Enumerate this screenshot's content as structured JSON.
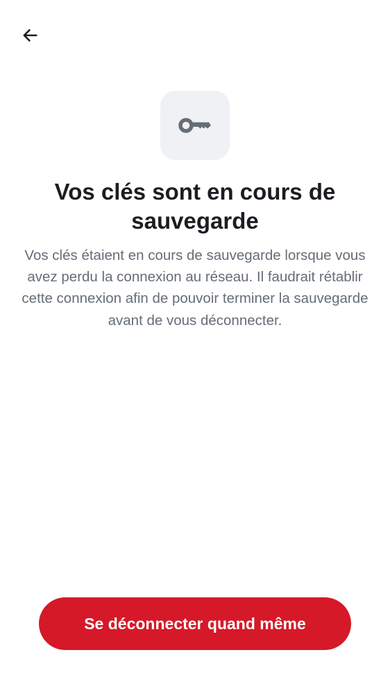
{
  "header": {
    "back_icon": "arrow-left-icon"
  },
  "main": {
    "icon": "key-icon",
    "title": "Vos clés sont en cours de sauvegarde",
    "description": "Vos clés étaient en cours de sauvegarde lorsque vous avez perdu la connexion au réseau. Il faudrait rétablir cette connexion afin de pouvoir terminer la sauvegarde avant de vous déconnecter."
  },
  "footer": {
    "signout_label": "Se déconnecter quand même"
  },
  "colors": {
    "accent": "#d51928",
    "title": "#1b1d22",
    "body_text": "#656d77",
    "icon_tile": "#f0f1f4",
    "icon": "#656d77"
  }
}
